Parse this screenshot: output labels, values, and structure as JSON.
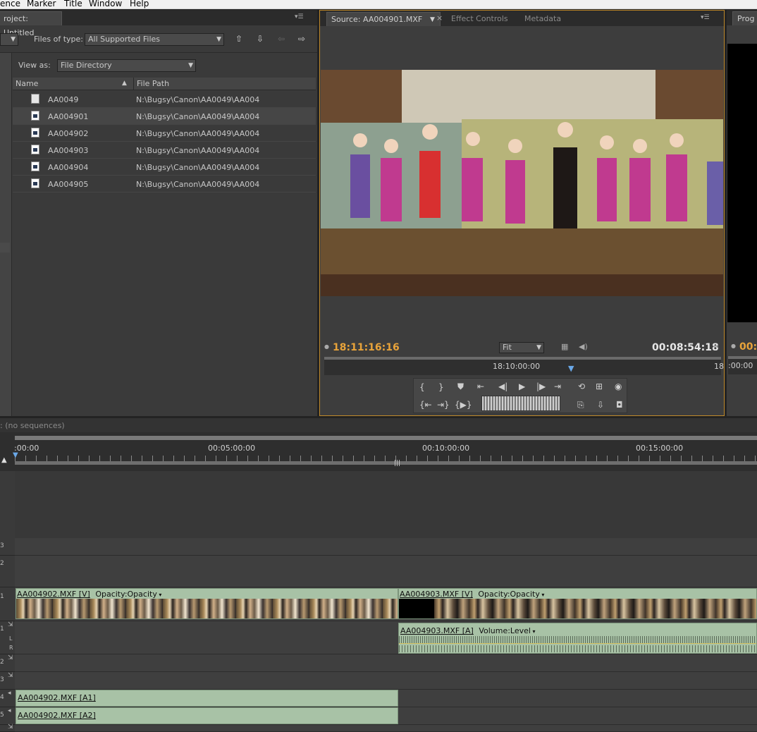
{
  "menubar": {
    "items": [
      "ence",
      "Marker",
      "Title",
      "Window",
      "Help"
    ]
  },
  "project_panel": {
    "tab_title": "roject: Untitled",
    "files_of_type_label": "Files of type:",
    "files_of_type_value": "All Supported Files",
    "view_as_label": "View as:",
    "view_as_value": "File Directory",
    "columns": [
      "Name",
      "File Path"
    ],
    "rows": [
      {
        "name": "AA0049",
        "path": "N:\\Bugsy\\Canon\\AA0049\\AA004",
        "icon": "document-icon"
      },
      {
        "name": "AA004901",
        "path": "N:\\Bugsy\\Canon\\AA0049\\AA004",
        "icon": "media-file-icon"
      },
      {
        "name": "AA004902",
        "path": "N:\\Bugsy\\Canon\\AA0049\\AA004",
        "icon": "media-file-icon"
      },
      {
        "name": "AA004903",
        "path": "N:\\Bugsy\\Canon\\AA0049\\AA004",
        "icon": "media-file-icon"
      },
      {
        "name": "AA004904",
        "path": "N:\\Bugsy\\Canon\\AA0049\\AA004",
        "icon": "media-file-icon"
      },
      {
        "name": "AA004905",
        "path": "N:\\Bugsy\\Canon\\AA0049\\AA004",
        "icon": "media-file-icon"
      }
    ]
  },
  "source_monitor": {
    "tabs": [
      "Source: AA004901.MXF",
      "Effect Controls",
      "Metadata"
    ],
    "close_glyph": "×",
    "timecode_left": "18:11:16:16",
    "timecode_right": "00:08:54:18",
    "zoom_value": "Fit",
    "ruler_time": "18:10:00:00",
    "ruler_right": "18"
  },
  "program_monitor": {
    "tab": "Prog",
    "timecode": "00:0",
    "ruler": ":00:00"
  },
  "timeline": {
    "tab_title": ": (no sequences)",
    "ruler_labels": [
      ":00:00",
      "00:05:00:00",
      "00:10:00:00",
      "00:15:00:00"
    ],
    "track_labels": [
      "3",
      "2",
      "1",
      "1",
      "2",
      "3",
      "4",
      "5"
    ],
    "audio_sub_labels": [
      "L",
      "R"
    ],
    "clips": {
      "v1_a": {
        "name": "AA004902.MXF [V]",
        "fx": "Opacity:Opacity"
      },
      "v1_b": {
        "name": "AA004903.MXF [V]",
        "fx": "Opacity:Opacity"
      },
      "a1_b": {
        "name": "AA004903.MXF [A]",
        "fx": "Volume:Level"
      },
      "a4_a": {
        "name": "AA004902.MXF [A1]"
      },
      "a5_a": {
        "name": "AA004902.MXF [A2]"
      }
    }
  },
  "colors": {
    "accent_timecode": "#e8a33a",
    "clip_green": "#a8c2a6",
    "panel_bg": "#3a3a3a"
  }
}
